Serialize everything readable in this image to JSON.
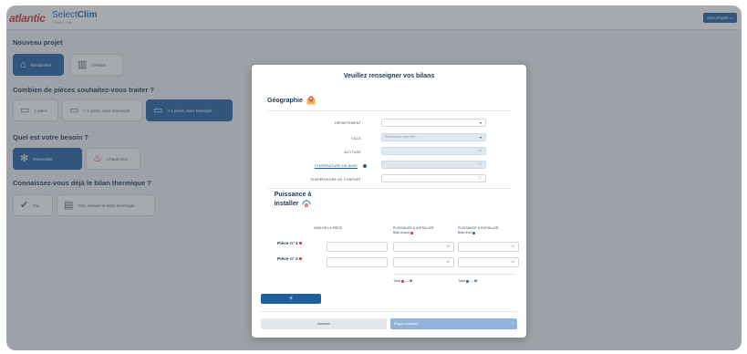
{
  "header": {
    "brand": "atlantic",
    "app_name_light": "Select",
    "app_name_bold": "Clim",
    "app_sub": "Bilan & Calc",
    "my_projects_label": "Mes projets",
    "accent_color": "#1f5fa0",
    "brand_color": "#d9302f"
  },
  "background": {
    "new_project": {
      "title": "Nouveau projet",
      "options": [
        {
          "label": "Résidentiel",
          "icon": "house-icon",
          "active": true
        },
        {
          "label": "Tertiaire",
          "icon": "building-icon",
          "active": false
        }
      ]
    },
    "rooms": {
      "title": "Combien de pièces souhaitez-vous traiter ?",
      "options": [
        {
          "label": "1 pièce",
          "icon": "ac-unit-icon",
          "active": false
        },
        {
          "label": "> 1 pièce, avec Monosplit",
          "icon": "ac-unit-icon",
          "active": false
        },
        {
          "label": "> 1 pièce, avec Multisplit",
          "icon": "ac-unit-icon",
          "active": true
        }
      ]
    },
    "need": {
      "title": "Quel est votre besoin ?",
      "options": [
        {
          "label": "Réversible",
          "icon": "flame-snow-icon",
          "active": true
        },
        {
          "label": "Chaud seul",
          "icon": "flame-icon",
          "active": false
        }
      ]
    },
    "thermal": {
      "title": "Connaissez-vous déjà le bilan thermique ?",
      "options": [
        {
          "label": "Oui",
          "icon": "check-circle-icon",
          "active": false
        },
        {
          "label": "Non, réaliser le bilan thermique",
          "icon": "document-icon",
          "active": false
        }
      ]
    }
  },
  "modal": {
    "title": "Veuillez renseigner vos bilans",
    "geography": {
      "title": "Géographie",
      "icon": "map-pin-icon",
      "fields": [
        {
          "label": "DÉPARTEMENT",
          "value": "",
          "placeholder": "",
          "type": "select",
          "disabled": false
        },
        {
          "label": "VILLE",
          "value": "",
          "placeholder": "Rechercher une ville...",
          "type": "select",
          "disabled": true
        },
        {
          "label": "ALTITUDE",
          "value": "",
          "placeholder": "",
          "unit": "m",
          "disabled": true
        },
        {
          "label": "TEMPÉRATURE DE BASE",
          "value": "",
          "placeholder": "",
          "unit": "°C",
          "disabled": true,
          "info": true
        },
        {
          "label": "TEMPÉRATURE DE CONFORT",
          "value": "",
          "placeholder": "",
          "unit": "°C",
          "disabled": false
        }
      ]
    },
    "power": {
      "title_line1": "Puissance à",
      "title_line2": "installer",
      "icon": "thermometer-icon",
      "col_room": "NOM DE LA PIÈCE",
      "col_heat": "PUISSANCE À INSTALLER",
      "col_heat_sub": "Bilan chaud",
      "col_cold": "PUISSANCE À INSTALLER",
      "col_cold_sub": "Bilan froid",
      "unit": "W",
      "rows": [
        {
          "label": "Pièce n° 1",
          "name": "",
          "heat": "",
          "cold": ""
        },
        {
          "label": "Pièce n° 2",
          "name": "",
          "heat": "",
          "cold": ""
        }
      ],
      "total_label": "Total",
      "total_heat": "- - W",
      "total_cold": "- - W"
    },
    "add_label": "+",
    "cancel_label": "Annuler",
    "next_label": "Étape suivante"
  }
}
